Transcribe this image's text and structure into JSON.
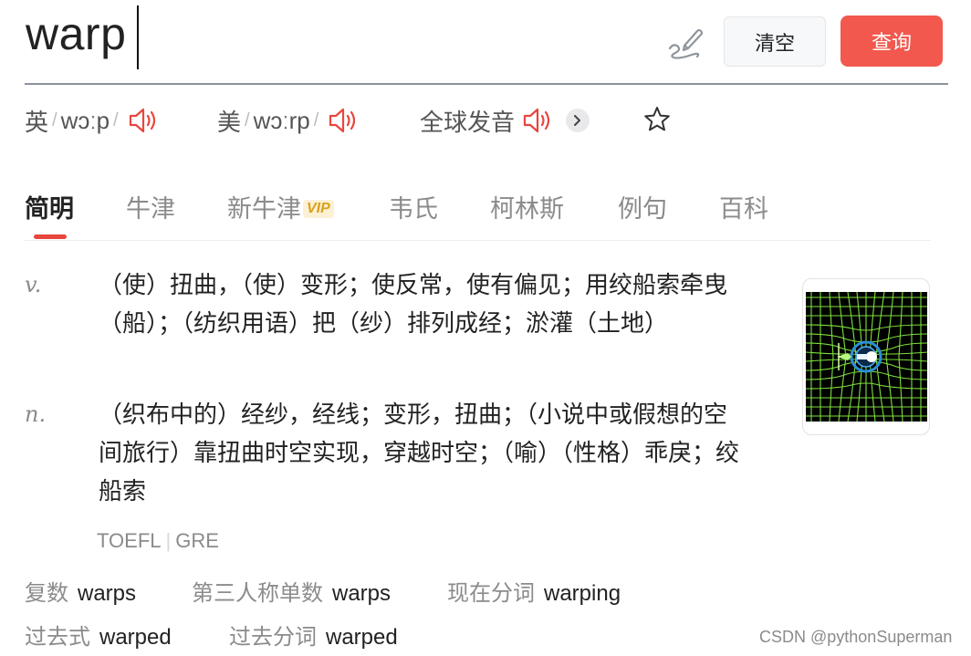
{
  "search": {
    "query": "warp"
  },
  "toolbar": {
    "clear_label": "清空",
    "search_label": "查询"
  },
  "pronunciation": {
    "uk": {
      "label": "英",
      "phonetic": "wɔːp"
    },
    "us": {
      "label": "美",
      "phonetic": "wɔːrp"
    },
    "global_label": "全球发音"
  },
  "tabs": [
    "简明",
    "牛津",
    "新牛津",
    "韦氏",
    "柯林斯",
    "例句",
    "百科"
  ],
  "vip_badge": "VIP",
  "definitions": [
    {
      "pos": "v.",
      "text": "（使）扭曲，（使）变形；使反常，使有偏见；用绞船索牵曳（船）；（纺织用语）把（纱）排列成经；淤灌（土地）"
    },
    {
      "pos": "n.",
      "text": "（织布中的）经纱，经线；变形，扭曲；（小说中或假想的空间旅行）靠扭曲时空实现，穿越时空；（喻）（性格）乖戾；绞船索"
    }
  ],
  "exams": [
    "TOEFL",
    "GRE"
  ],
  "word_forms": [
    {
      "label": "复数",
      "value": "warps"
    },
    {
      "label": "第三人称单数",
      "value": "warps"
    },
    {
      "label": "现在分词",
      "value": "warping"
    },
    {
      "label": "过去式",
      "value": "warped"
    },
    {
      "label": "过去分词",
      "value": "warped"
    }
  ],
  "watermark": "CSDN @pythonSuperman",
  "colors": {
    "accent": "#f2584e",
    "speaker": "#e8463e",
    "tab_indicator": "#e8463e",
    "grid": "#7ee03c"
  },
  "icons": [
    "handwriting-icon",
    "speaker-icon",
    "chevron-right-icon",
    "star-icon"
  ]
}
